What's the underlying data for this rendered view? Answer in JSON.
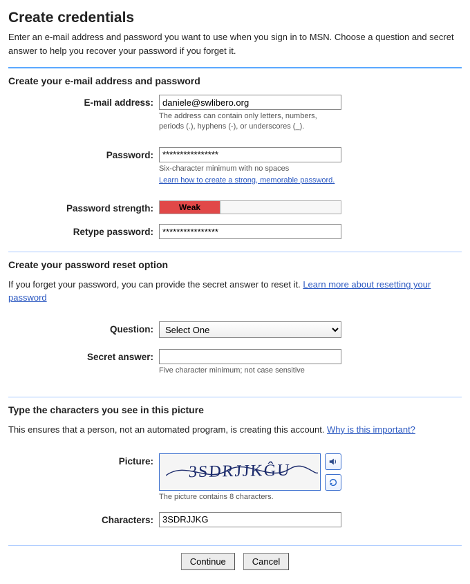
{
  "title": "Create credentials",
  "intro": "Enter an e-mail address and password you want to use when you sign in to MSN. Choose a question and secret answer to help you recover your password if you forget it.",
  "section1": {
    "heading": "Create your e-mail address and password",
    "email_label": "E-mail address:",
    "email_value": "daniele@swlibero.org",
    "email_hint": "The address can contain only letters, numbers, periods (.), hyphens (-), or underscores (_).",
    "password_label": "Password:",
    "password_value": "****************",
    "password_hint1": "Six-character minimum with no spaces",
    "password_hint_link": "Learn how to create a strong, memorable password.",
    "strength_label": "Password strength:",
    "strength_text": "Weak",
    "retype_label": "Retype password:",
    "retype_value": "****************"
  },
  "section2": {
    "heading": "Create your password reset option",
    "desc_pre": "If you forget your password, you can provide the secret answer to reset it. ",
    "desc_link": "Learn more about resetting your password",
    "question_label": "Question:",
    "question_selected": "Select One",
    "answer_label": "Secret answer:",
    "answer_value": "",
    "answer_hint": "Five character minimum; not case sensitive"
  },
  "section3": {
    "heading": "Type the characters you see in this picture",
    "desc_pre": "This ensures that a person, not an automated program, is creating this account. ",
    "desc_link": "Why is this important?",
    "picture_label": "Picture:",
    "captcha_text": "3SDRJJKĜU",
    "picture_hint": "The picture contains 8 characters.",
    "chars_label": "Characters:",
    "chars_value": "3SDRJJKG"
  },
  "buttons": {
    "continue": "Continue",
    "cancel": "Cancel"
  }
}
